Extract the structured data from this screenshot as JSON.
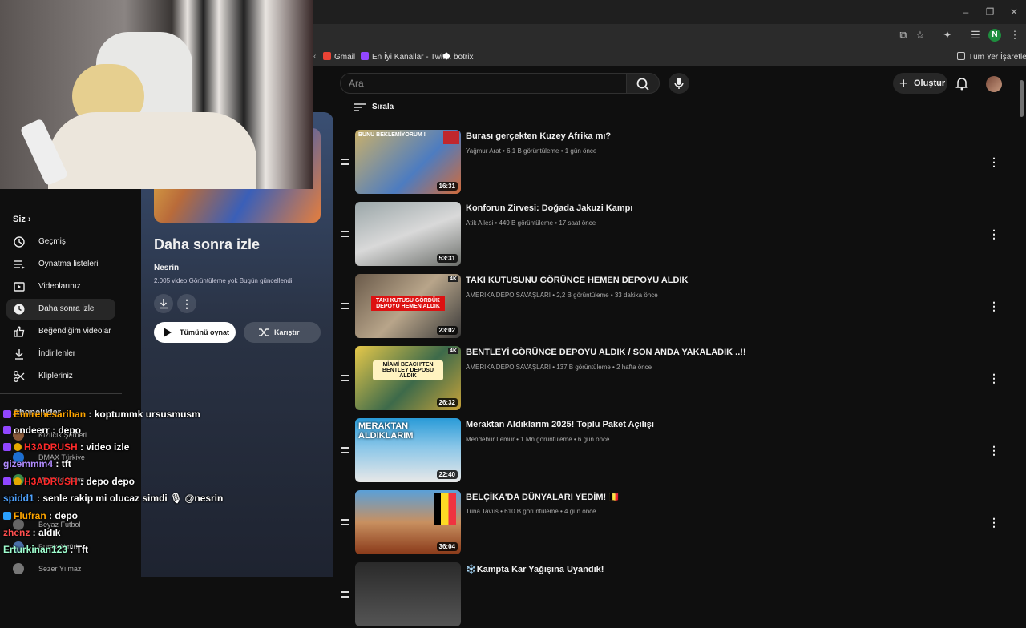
{
  "bookmarks": [
    {
      "label": "Gmail",
      "color": "#ea4335"
    },
    {
      "label": "En İyi Kanallar - Twit...",
      "color": "#9146ff"
    },
    {
      "label": "botrix",
      "color": "#ffffff"
    }
  ],
  "bookmarks_all": "Tüm Yer İşaretleri",
  "profile_initial": "N",
  "header": {
    "search_placeholder": "Ara",
    "create_label": "Oluştur"
  },
  "sidebar": {
    "you_label": "Siz",
    "items": [
      {
        "label": "Geçmiş",
        "icon": "history-icon"
      },
      {
        "label": "Oynatma listeleri",
        "icon": "playlists-icon"
      },
      {
        "label": "Videolarınız",
        "icon": "your-videos-icon"
      },
      {
        "label": "Daha sonra izle",
        "icon": "clock-icon",
        "active": true
      },
      {
        "label": "Beğendiğim videolar",
        "icon": "thumb-up-icon"
      },
      {
        "label": "İndirilenler",
        "icon": "download-icon"
      },
      {
        "label": "Klipleriniz",
        "icon": "scissors-icon"
      }
    ],
    "subscriptions_title": "Abonelikler",
    "subscriptions": [
      "Kızılcık Şerbeti",
      "DMAX Türkiye",
      "My Wild News",
      "Beyaz Futbol",
      "Burak Aktürk",
      "Sezer Yılmaz"
    ]
  },
  "playlist": {
    "title": "Daha sonra izle",
    "owner": "Nesrin",
    "stats": "2.005 video   Görüntüleme yok   Bugün güncellendi",
    "play_all": "Tümünü oynat",
    "shuffle": "Karıştır"
  },
  "sort_label": "Sırala",
  "videos": [
    {
      "title": "Burası gerçekten Kuzey Afrika mı?",
      "channel": "Yağmur Arat",
      "views": "6,1 B görüntüleme",
      "age": "1 gün önce",
      "duration": "16:31",
      "thumb_text": "BUNU BEKLEMİYORUM !"
    },
    {
      "title": "Konforun Zirvesi: Doğada Jakuzi Kampı",
      "channel": "Atik Ailesi",
      "views": "449 B görüntüleme",
      "age": "17 saat önce",
      "duration": "53:31",
      "thumb_text": ""
    },
    {
      "title": "TAKI KUTUSUNU GÖRÜNCE HEMEN DEPOYU ALDIK",
      "channel": "AMERİKA DEPO SAVAŞLARI",
      "views": "2,2 B görüntüleme",
      "age": "33 dakika önce",
      "duration": "23:02",
      "thumb_text": "TAKI KUTUSU GÖRDÜK DEPOYU HEMEN ALDIK"
    },
    {
      "title": "BENTLEYİ GÖRÜNCE DEPOYU ALDIK / SON ANDA YAKALADIK ..!!",
      "channel": "AMERİKA DEPO SAVAŞLARI",
      "views": "137 B görüntüleme",
      "age": "2 hafta önce",
      "duration": "26:32",
      "thumb_text": "MİAMİ BEACH'TEN BENTLEY DEPOSU ALDIK"
    },
    {
      "title": "Meraktan Aldıklarım 2025! Toplu Paket Açılışı",
      "channel": "Mendebur Lemur",
      "views": "1 Mn görüntüleme",
      "age": "6 gün önce",
      "duration": "22:40",
      "thumb_text": "MERAKTAN ALDIKLARIM"
    },
    {
      "title": "BELÇİKA'DA DÜNYALARI YEDİM! 🇧🇪",
      "channel": "Tuna Tavus",
      "views": "610 B görüntüleme",
      "age": "4 gün önce",
      "duration": "36:04",
      "thumb_text": ""
    },
    {
      "title": "❄️Kampta Kar Yağışına Uyandık!",
      "channel": "",
      "views": "",
      "age": "",
      "duration": "",
      "thumb_text": ""
    }
  ],
  "chat": [
    {
      "user": "Emirenesarihan",
      "user_color": "#ffa500",
      "text": " : koptummk ursusmusm"
    },
    {
      "user": "ondeerr",
      "user_color": "#ffffff",
      "text": " : depo"
    },
    {
      "user": "H3ADRUSH",
      "user_color": "#ff2b2b",
      "text": " : video izle"
    },
    {
      "user": "gizemmm4",
      "user_color": "#b28cff",
      "text": " : tft"
    },
    {
      "user": "H3ADRUSH",
      "user_color": "#ff2b2b",
      "text": " : depo depo"
    },
    {
      "user": "spidd1",
      "user_color": "#4fa3ff",
      "text": " : senle rakip mi olucaz simdi  🎙 @nesrin"
    },
    {
      "user": "Flufran",
      "user_color": "#ffa500",
      "text": " : depo"
    },
    {
      "user": "zhenz",
      "user_color": "#ff4f4f",
      "text": " : aldık"
    },
    {
      "user": "Erturkinan123",
      "user_color": "#9fffcf",
      "text": " : Tft"
    }
  ]
}
